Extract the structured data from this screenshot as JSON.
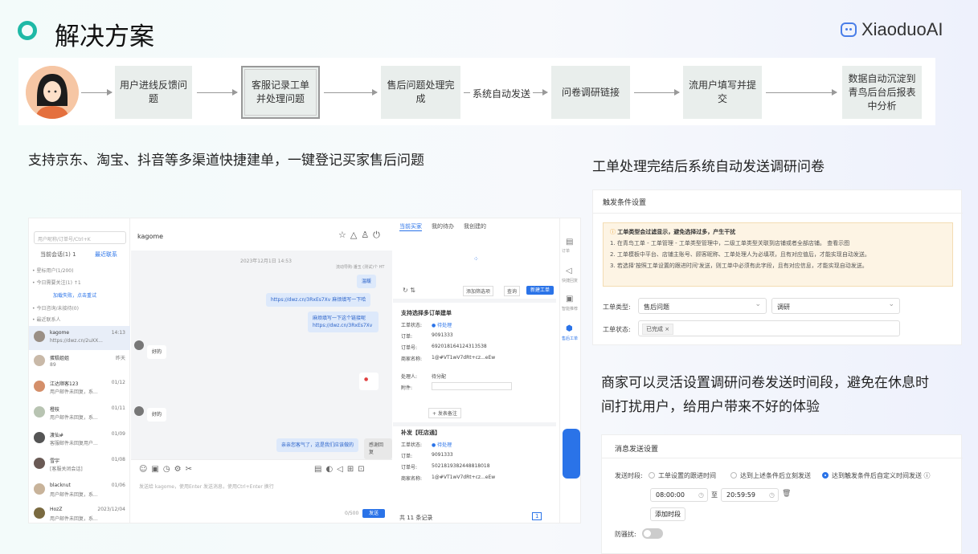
{
  "header": {
    "title": "解决方案",
    "logo_text": "XiaoduoAI"
  },
  "flow": {
    "steps": [
      "用户进线反馈问题",
      "客服记录工单并处理问题",
      "售后问题处理完成",
      "问卷调研链接",
      "流用户填写并提交",
      "数据自动沉淀到青鸟后台后报表中分析"
    ],
    "auto_send_label": "系统自动发送"
  },
  "left_desc": "支持京东、淘宝、抖音等多渠道快捷建单，一键登记买家售后问题",
  "right_desc1": "工单处理完结后系统自动发送调研问卷",
  "right_desc2": "商家可以灵活设置调研问卷发送时间段，避免在休息时间打扰用户，给用户带来不好的体验",
  "chat_app": {
    "search_placeholder": "用户昵称/订单号/Ctrl+K",
    "tabs": [
      "当前会话(1) 1",
      "最近联系"
    ],
    "sections": [
      "• 星标用户(1/200)",
      "• 今日需要关注(1) ↑1",
      "加载失败，点击重试",
      "• 今日咨询/未接待(0)",
      "• 最近联系人"
    ],
    "contacts": [
      {
        "name": "kagome",
        "time": "14:13",
        "msg": "https://dwz.cn/2uXX..."
      },
      {
        "name": "蛋糕姐姐",
        "time": "昨天",
        "msg": "89"
      },
      {
        "name": "江达顺客123",
        "time": "01/12",
        "msg": "用户邮件未回复，系..."
      },
      {
        "name": "橙枝",
        "time": "01/11",
        "msg": "用户邮件未回复，系..."
      },
      {
        "name": "渡仙#",
        "time": "01/09",
        "msg": "客服邮件未回复用户..."
      },
      {
        "name": "雪宇",
        "time": "01/08",
        "msg": "[客服关闭会话]"
      },
      {
        "name": "blacknut",
        "time": "01/06",
        "msg": "用户邮件未回复，系..."
      },
      {
        "name": "HozZ",
        "time": "2023/12/04",
        "msg": "用户邮件未回复，系..."
      }
    ],
    "chat_user": "kagome",
    "chat_date": "2023年12月1日 14:53",
    "messages": [
      "温暖",
      "https://dwz.cn/3RxEs7Xv 麻烦填写一下哈",
      "麻烦填写一下这个链接呢 https://dwz.cn/3RxEs7Xv",
      "好的",
      "好的",
      "亲亲您客气了，这是我们应该做的",
      "感谢回复"
    ],
    "sender_label": "流动导购·潘玉 (测试)个 HT",
    "input_placeholder": "发送给 kagome，使用Enter 发送消息，使用Ctrl+Enter 换行",
    "char_count": "0/500",
    "send_label": "发送",
    "right_tabs": [
      "当前买家",
      "我的待办",
      "我创建的"
    ],
    "create_btn": "新建工单",
    "filter_btn": "查询",
    "filter_select": "添加筛选项",
    "ticket_title": "支持选择多订单建单",
    "ticket_fields": [
      [
        "工单状态:",
        "● 待处理"
      ],
      [
        "订单:",
        "9091333"
      ],
      [
        "订单号:",
        "692018164124313538"
      ],
      [
        "商家名称:",
        "1@#VT1wV7dRt+cz...eEw"
      ],
      [
        "处理人:",
        "待分配"
      ],
      [
        "附件:",
        ""
      ]
    ],
    "ticket2_title": "补发【旺店通】",
    "ticket2_fields": [
      [
        "工单状态:",
        "● 待处理"
      ],
      [
        "订单:",
        "9091333"
      ],
      [
        "订单号:",
        "5021819382448818018"
      ],
      [
        "商家名称:",
        "1@#VT1wV7dRt+cz...eEw"
      ]
    ],
    "pager_total": "共 11 条记录",
    "page": "1",
    "add_remark": "+ 发表备注",
    "sidebar_right": [
      "订单",
      "快捷回复",
      "智能推荐",
      "售后工单"
    ]
  },
  "trigger_settings": {
    "header": "触发条件设置",
    "warn_title": "工单类型会过滤显示，避免选择过多，产生干扰",
    "warn_lines": [
      "1. 在青鸟工单 - 工单管理 - 工单类型管理中，二级工单类型关联到店铺或者全部店铺。 查看示图",
      "2. 工单模板中平台、店铺主账号、顾客昵称、工单处理人为必填项，且有对应值后，才能实现自动发送。",
      "3. 若选择'按照工单设置的跟进时间'发送，则工单中必须有此字段，且有对应信息，才能实现自动发送。"
    ],
    "type_label": "工单类型:",
    "type_value": "售后问题",
    "type_value2": "调研",
    "status_label": "工单状态:",
    "status_value": "已完成"
  },
  "message_settings": {
    "header": "消息发送设置",
    "time_label": "发送时段:",
    "options": [
      "工单设置的跟进时间",
      "达到上述条件后立刻发送",
      "达到触发条件后自定义时间发送"
    ],
    "start": "08:00:00",
    "to": "至",
    "end": "20:59:59",
    "add_period": "添加时段",
    "anti_disturb": "防骚扰:"
  }
}
